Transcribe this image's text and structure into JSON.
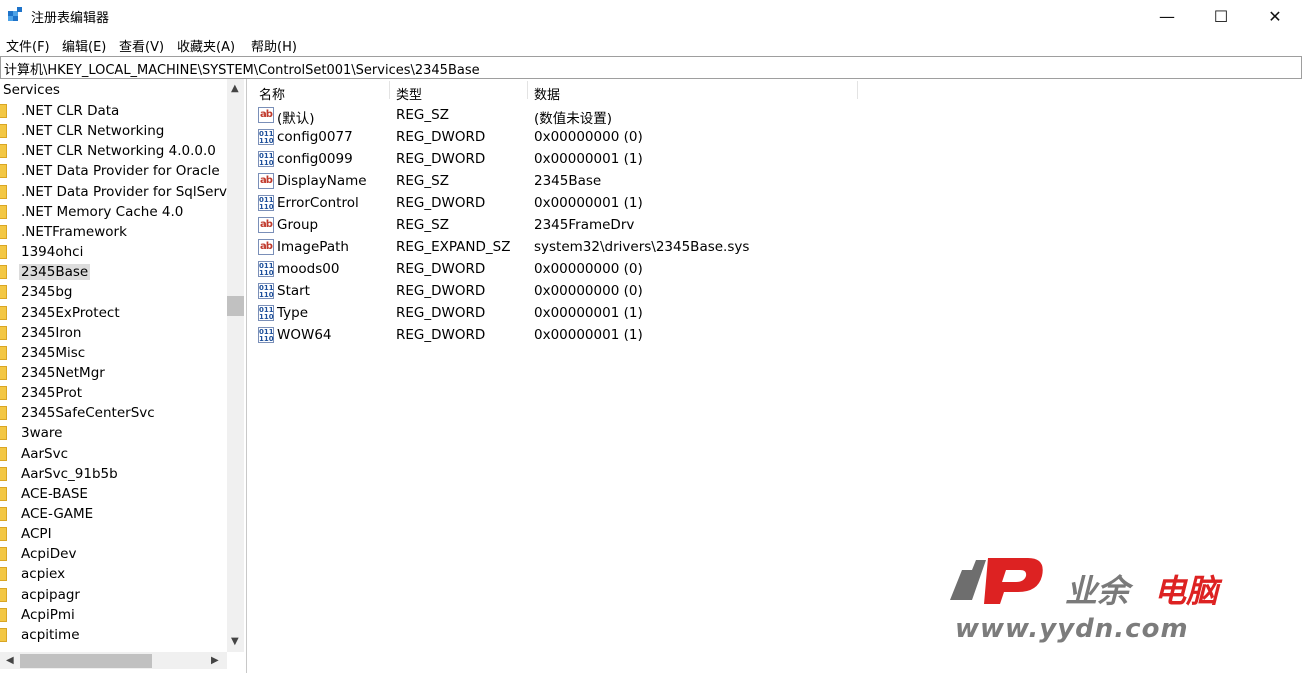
{
  "window": {
    "title": "注册表编辑器",
    "minimize": "—",
    "maximize": "☐",
    "close": "✕"
  },
  "menu": [
    "文件(F)",
    "编辑(E)",
    "查看(V)",
    "收藏夹(A)",
    "帮助(H)"
  ],
  "address": "计算机\\HKEY_LOCAL_MACHINE\\SYSTEM\\ControlSet001\\Services\\2345Base",
  "tree": {
    "root": "Services",
    "selected": "2345Base",
    "items": [
      ".NET CLR Data",
      ".NET CLR Networking",
      ".NET CLR Networking 4.0.0.0",
      ".NET Data Provider for Oracle",
      ".NET Data Provider for SqlServer",
      ".NET Memory Cache 4.0",
      ".NETFramework",
      "1394ohci",
      "2345Base",
      "2345bg",
      "2345ExProtect",
      "2345Iron",
      "2345Misc",
      "2345NetMgr",
      "2345Prot",
      "2345SafeCenterSvc",
      "3ware",
      "AarSvc",
      "AarSvc_91b5b",
      "ACE-BASE",
      "ACE-GAME",
      "ACPI",
      "AcpiDev",
      "acpiex",
      "acpipagr",
      "AcpiPmi",
      "acpitime"
    ]
  },
  "columns": {
    "name": "名称",
    "type": "类型",
    "data": "数据"
  },
  "values": [
    {
      "name": "(默认)",
      "type": "REG_SZ",
      "data": "(数值未设置)",
      "icon": "string-value-icon"
    },
    {
      "name": "config0077",
      "type": "REG_DWORD",
      "data": "0x00000000 (0)",
      "icon": "binary-value-icon"
    },
    {
      "name": "config0099",
      "type": "REG_DWORD",
      "data": "0x00000001 (1)",
      "icon": "binary-value-icon"
    },
    {
      "name": "DisplayName",
      "type": "REG_SZ",
      "data": "2345Base",
      "icon": "string-value-icon"
    },
    {
      "name": "ErrorControl",
      "type": "REG_DWORD",
      "data": "0x00000001 (1)",
      "icon": "binary-value-icon"
    },
    {
      "name": "Group",
      "type": "REG_SZ",
      "data": "2345FrameDrv",
      "icon": "string-value-icon"
    },
    {
      "name": "ImagePath",
      "type": "REG_EXPAND_SZ",
      "data": "system32\\drivers\\2345Base.sys",
      "icon": "string-value-icon"
    },
    {
      "name": "moods00",
      "type": "REG_DWORD",
      "data": "0x00000000 (0)",
      "icon": "binary-value-icon"
    },
    {
      "name": "Start",
      "type": "REG_DWORD",
      "data": "0x00000000 (0)",
      "icon": "binary-value-icon"
    },
    {
      "name": "Type",
      "type": "REG_DWORD",
      "data": "0x00000001 (1)",
      "icon": "binary-value-icon"
    },
    {
      "name": "WOW64",
      "type": "REG_DWORD",
      "data": "0x00000001 (1)",
      "icon": "binary-value-icon"
    }
  ],
  "icon_glyphs": {
    "string": "ab",
    "binary": "011\n110"
  },
  "watermark": {
    "logo": "yydn-logo",
    "brand_left": "业余",
    "brand_right": "电脑",
    "url": "www.yydn.com"
  }
}
